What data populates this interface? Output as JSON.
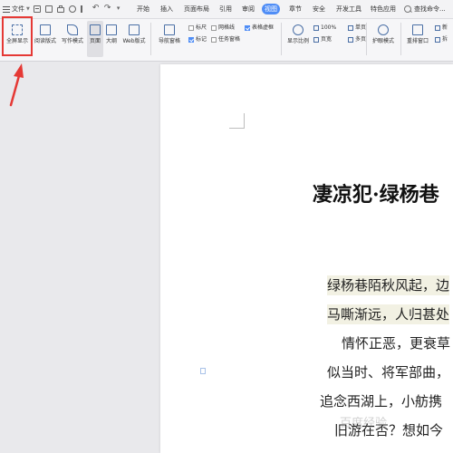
{
  "menubar": {
    "file_label": "文件",
    "tabs": [
      "开始",
      "插入",
      "页面布局",
      "引用",
      "审阅",
      "视图",
      "章节",
      "安全",
      "开发工具",
      "特色应用"
    ],
    "active_tab": "视图",
    "search_label": "查找命令..."
  },
  "ribbon": {
    "buttons": {
      "fullscreen": "全屏显示",
      "reading": "阅读版式",
      "writing": "写作模式",
      "page": "页面",
      "outline": "大纲",
      "web": "Web版式",
      "nav_pane": "导航窗格",
      "display_ratio": "显示比例",
      "eye_protect": "护眼模式",
      "rearrange": "重排窗口",
      "new_window": "新",
      "split": "拆"
    },
    "checks": {
      "ruler": "标尺",
      "gridlines": "网格线",
      "table_gridlines": "表格虚框",
      "markup": "标记",
      "task_pane": "任务窗格"
    },
    "zoom": {
      "percent": "100%",
      "single_page": "单页",
      "page_width": "页宽",
      "multi_page": "多页"
    }
  },
  "document": {
    "title": "凄凉犯·绿杨巷",
    "lines": [
      "绿杨巷陌秋风起，边",
      "马嘶渐远，人归甚处",
      "情怀正恶，更衰草",
      "似当时、将军部曲，",
      "追念西湖上，小舫携",
      "旧游在否？想如今"
    ]
  },
  "watermark_text": "百度经验"
}
